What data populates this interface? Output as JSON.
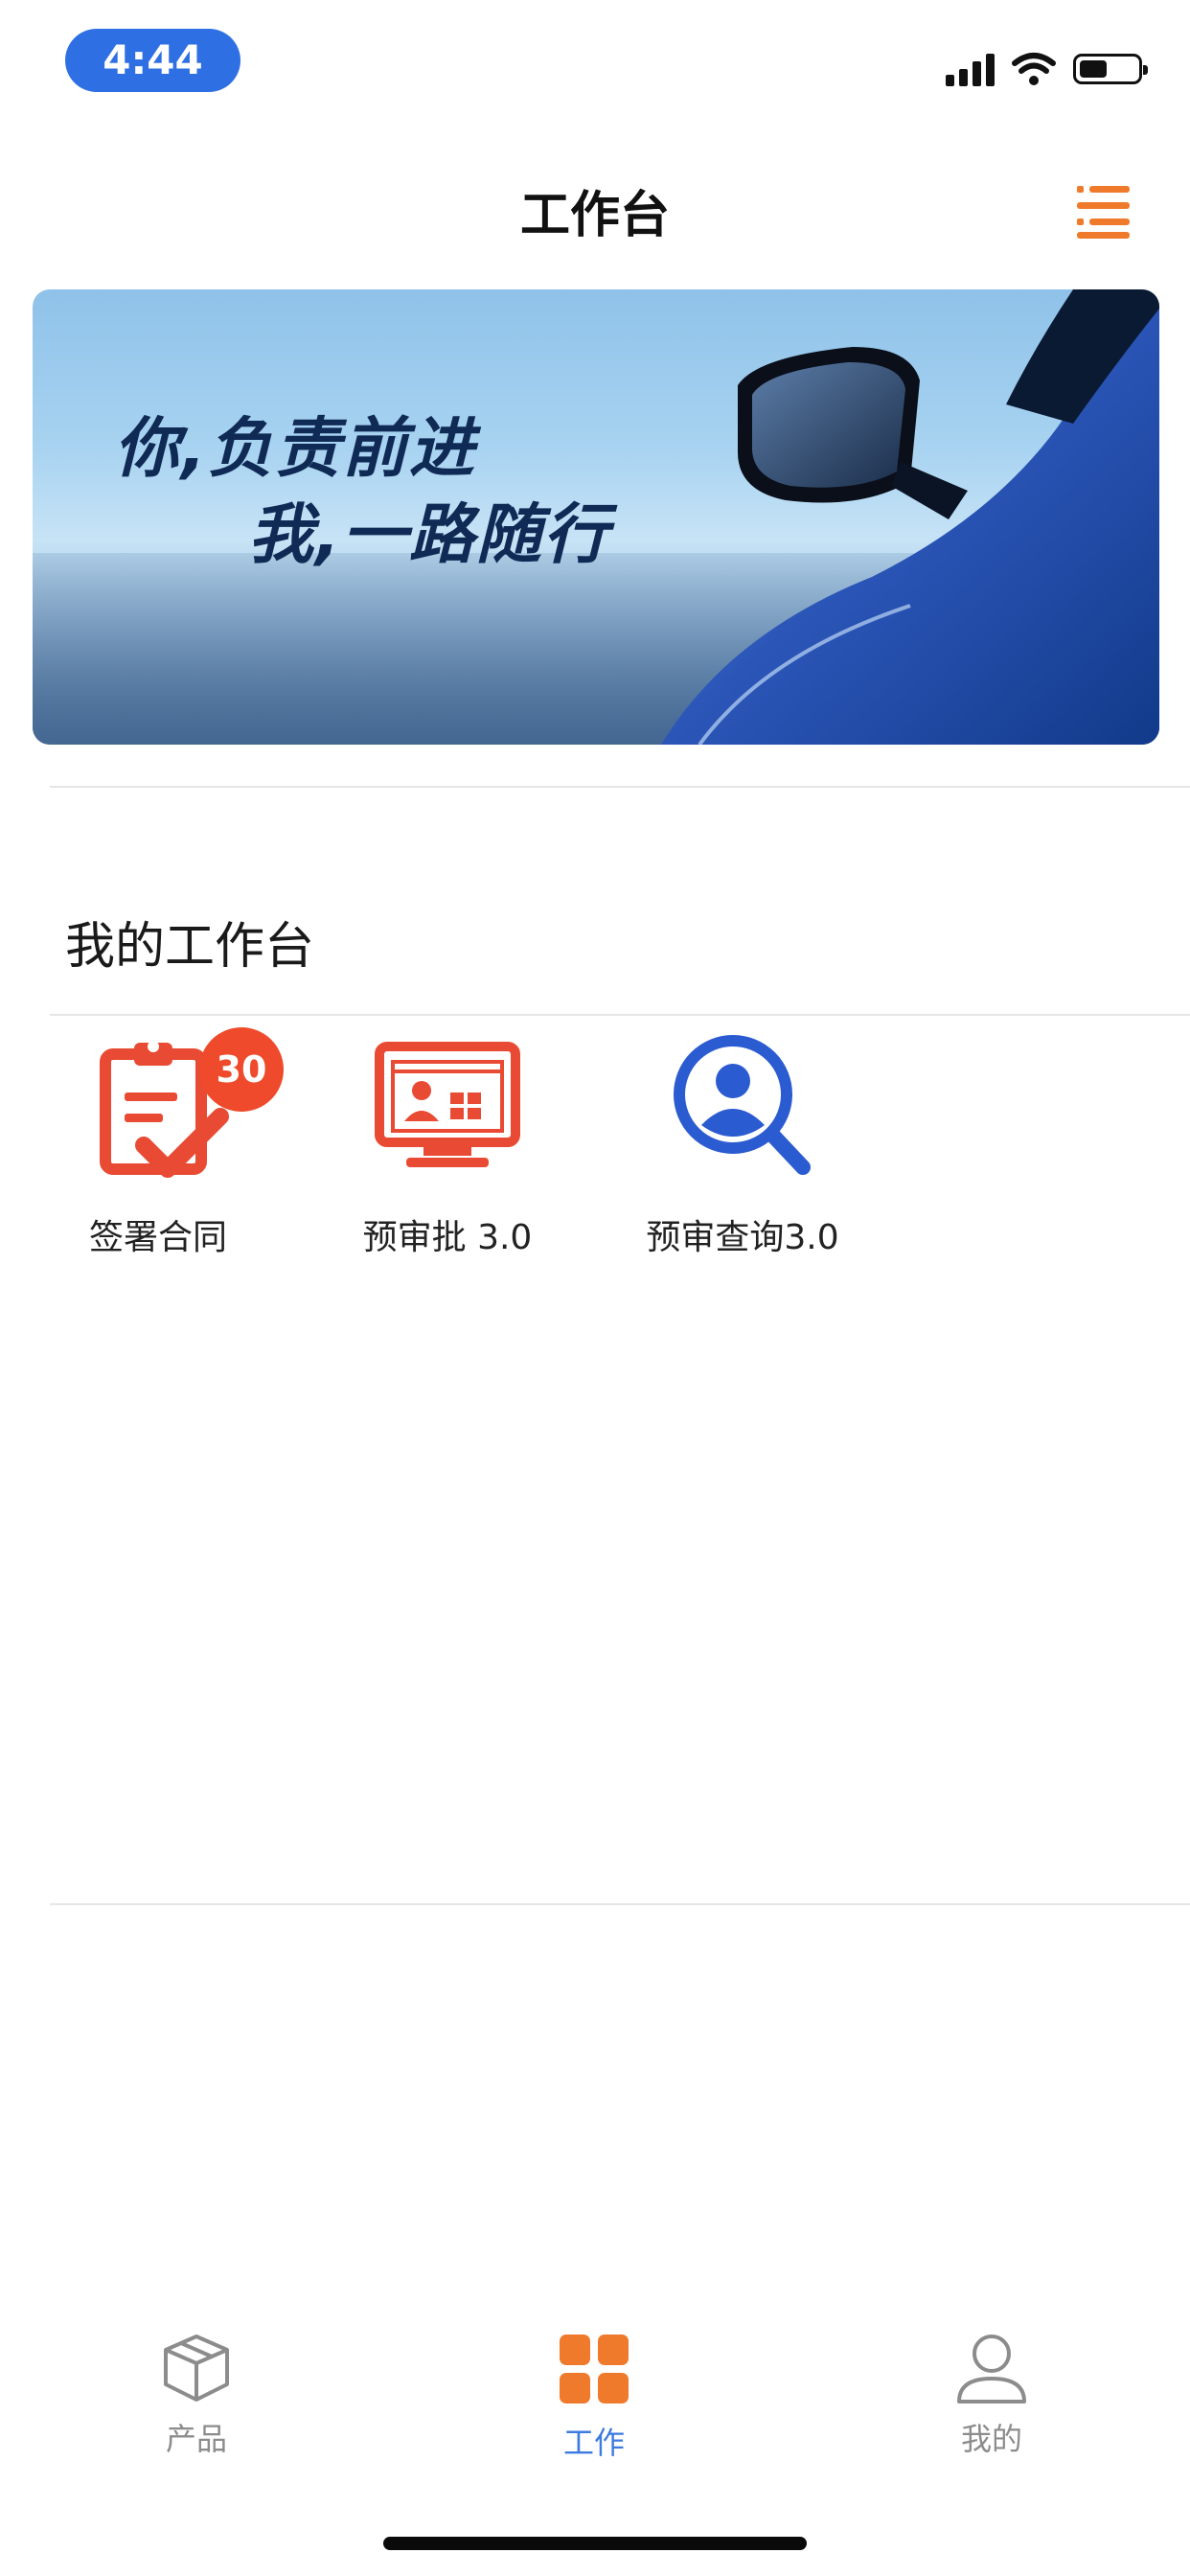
{
  "status_bar": {
    "time": "4:44"
  },
  "header": {
    "title": "工作台"
  },
  "banner": {
    "line1": "你,负责前进",
    "line2": "我,一路随行"
  },
  "section": {
    "title": "我的工作台"
  },
  "tiles": [
    {
      "label": "签署合同",
      "badge": "30"
    },
    {
      "label": "预审批 3.0"
    },
    {
      "label": "预审查询3.0"
    }
  ],
  "tabbar": {
    "items": [
      {
        "label": "产品"
      },
      {
        "label": "工作"
      },
      {
        "label": "我的"
      }
    ],
    "active": "工作"
  },
  "colors": {
    "accent": "#f07a2c",
    "time_pill": "#2f6fe4",
    "tile_red": "#e94a33",
    "tile_blue": "#2b5bd0",
    "badge": "#ee4a2b",
    "tab_inactive": "#8c8c8c",
    "tab_active_label": "#3d7be0"
  }
}
